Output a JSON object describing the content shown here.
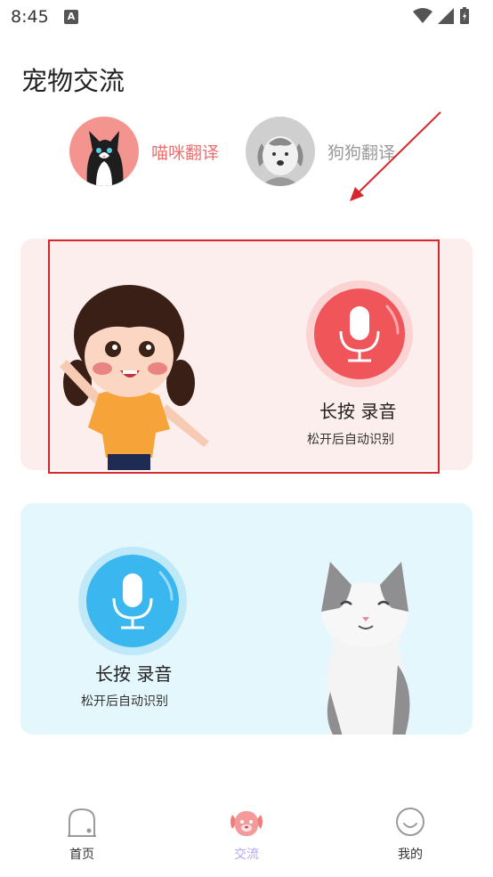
{
  "status_bar": {
    "time": "8:45",
    "notif_letter": "A"
  },
  "header": {
    "title": "宠物交流"
  },
  "switcher": {
    "cat_label": "喵咪翻译",
    "dog_label": "狗狗翻译"
  },
  "card_girl": {
    "title": "长按 录音",
    "hint": "松开后自动识别"
  },
  "card_cat": {
    "title": "长按 录音",
    "hint": "松开后自动识别"
  },
  "tabbar": {
    "items": [
      {
        "label": "首页",
        "icon": "home-icon"
      },
      {
        "label": "交流",
        "icon": "pet-chat-icon"
      },
      {
        "label": "我的",
        "icon": "smile-icon"
      }
    ]
  },
  "colors": {
    "accent_pink": "#ef6e6e",
    "accent_purple": "#b9a6f2",
    "card_pink_bg": "#fdeeee",
    "card_blue_bg": "#e3f7fc",
    "annotation_red": "#d8262e"
  }
}
